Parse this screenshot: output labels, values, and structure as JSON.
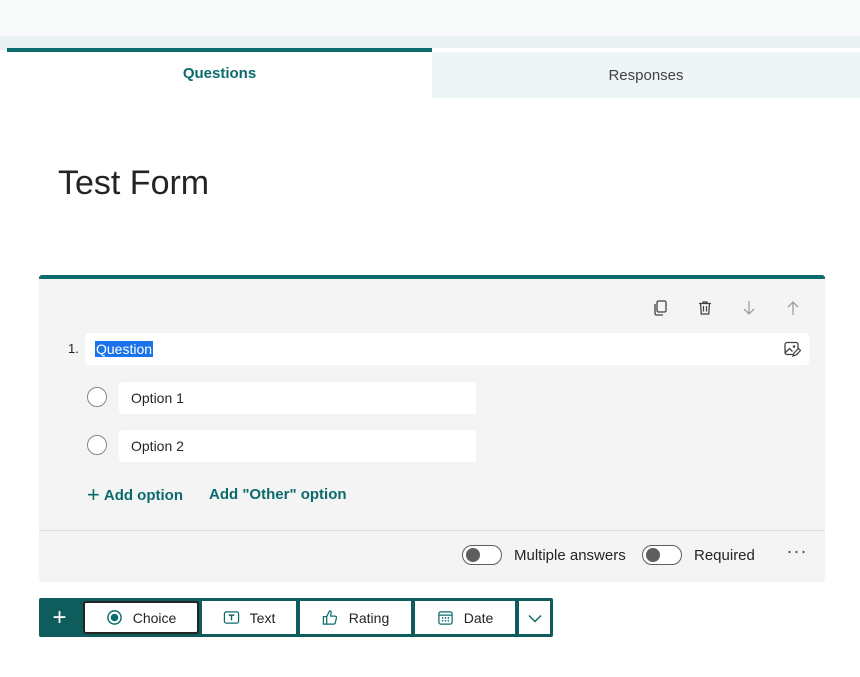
{
  "tabs": {
    "questions": "Questions",
    "responses": "Responses"
  },
  "form": {
    "title": "Test Form"
  },
  "question": {
    "number": "1.",
    "text": "Question",
    "options": [
      "Option 1",
      "Option 2"
    ],
    "add_option": "Add option",
    "add_other": "Add \"Other\" option",
    "multiple_answers_label": "Multiple answers",
    "required_label": "Required",
    "more": "···",
    "toolbar_icons": [
      "copy-icon",
      "delete-icon",
      "move-down-icon",
      "move-up-icon"
    ]
  },
  "add_question": {
    "plus": "+",
    "types": [
      {
        "label": "Choice",
        "icon": "radio-icon",
        "selected": true
      },
      {
        "label": "Text",
        "icon": "text-icon",
        "selected": false
      },
      {
        "label": "Rating",
        "icon": "thumbs-up-icon",
        "selected": false
      },
      {
        "label": "Date",
        "icon": "calendar-icon",
        "selected": false
      }
    ]
  },
  "colors": {
    "accent": "#0b6a6b",
    "selection": "#1a73e8",
    "card": "#f4f4f4"
  }
}
